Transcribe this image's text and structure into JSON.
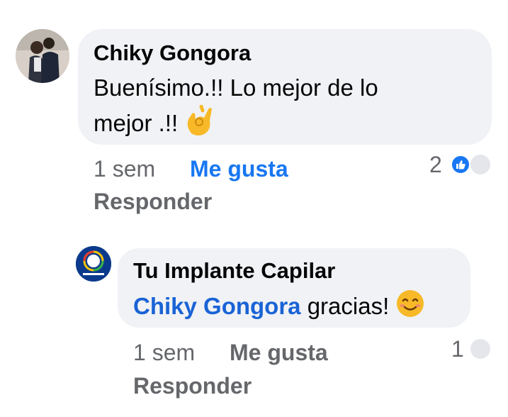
{
  "comment": {
    "author": "Chiky Gongora",
    "text_line1": "Buenísimo.!! Lo mejor de lo",
    "text_line2": "mejor .!!",
    "emoji": "ok-hand-emoji",
    "time": "1 sem",
    "like_label": "Me gusta",
    "reply_label": "Responder",
    "reaction_count": "2",
    "reaction_icon": "thumbs-up-icon"
  },
  "reply": {
    "author": "Tu Implante Capilar",
    "mention": "Chiky Gongora",
    "text": " gracias!",
    "emoji": "smiling-face-emoji",
    "time": "1 sem",
    "like_label": "Me gusta",
    "reply_label": "Responder",
    "reaction_count": "1"
  },
  "colors": {
    "bubble": "#f0f2f5",
    "link_blue": "#1877f2",
    "meta_gray": "#65676b"
  }
}
